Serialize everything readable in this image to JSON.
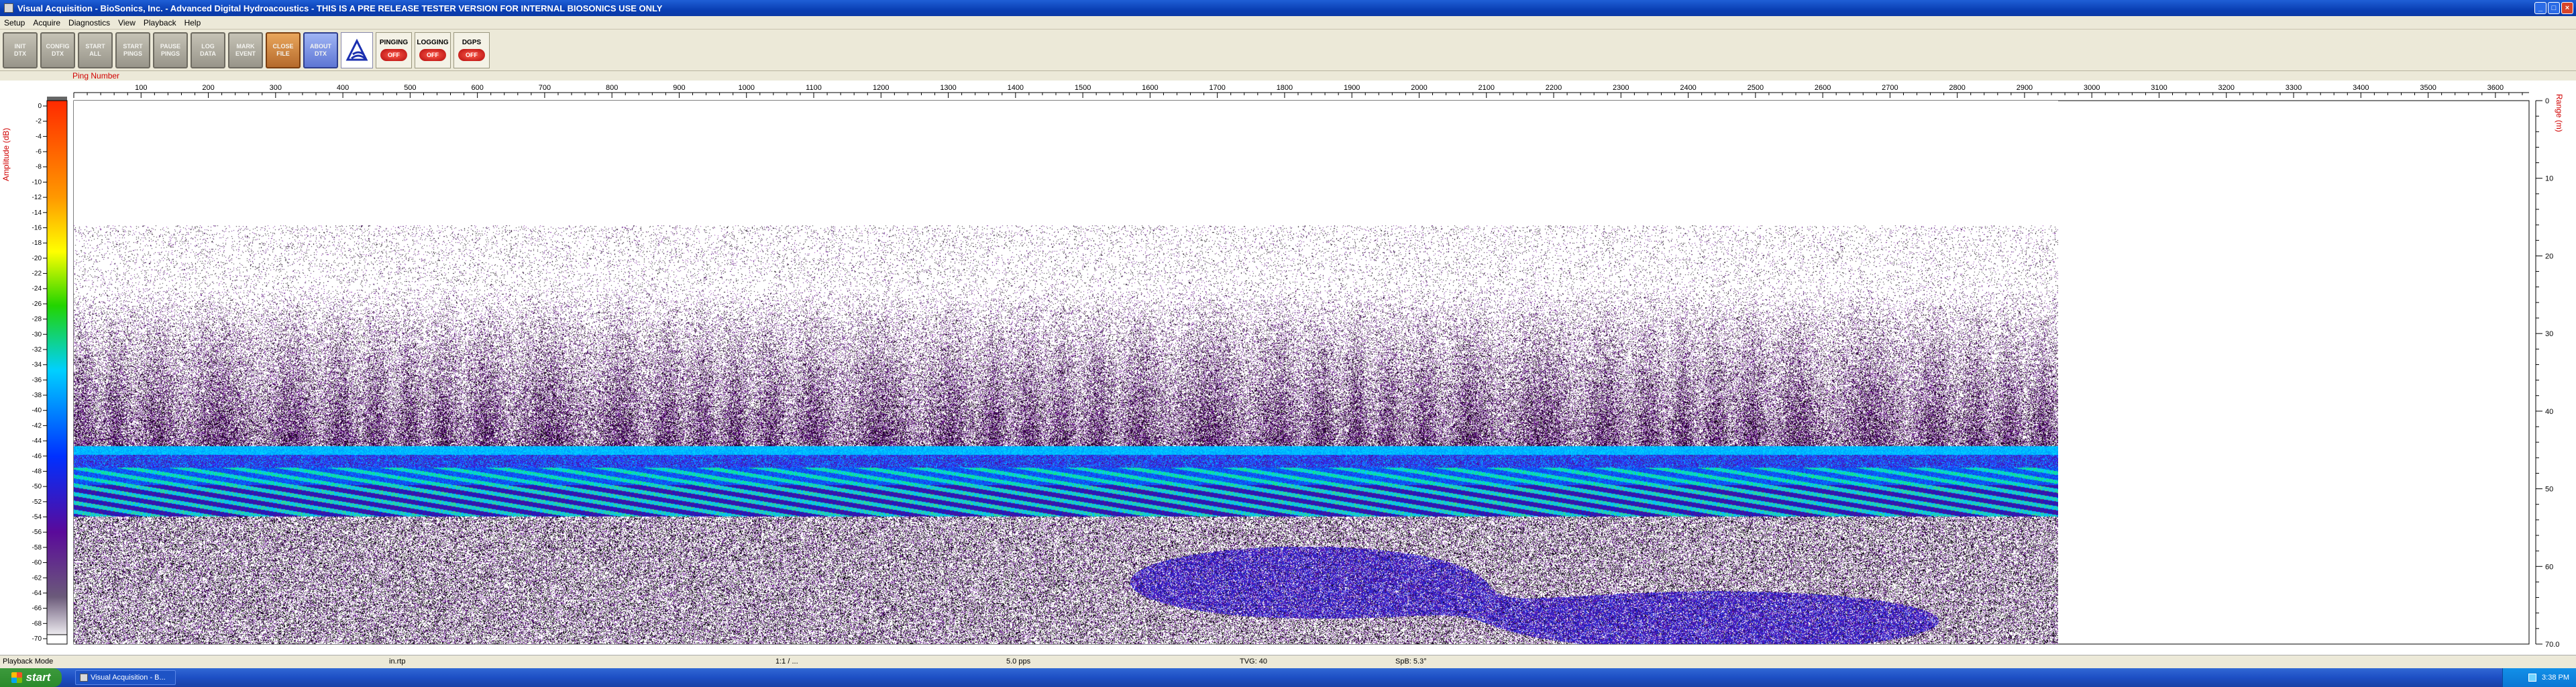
{
  "window": {
    "title": "Visual Acquisition  -  BioSonics, Inc.  -  Advanced Digital Hydroacoustics  -  THIS IS A PRE RELEASE TESTER VERSION FOR INTERNAL BIOSONICS USE ONLY"
  },
  "menu": [
    "Setup",
    "Acquire",
    "Diagnostics",
    "View",
    "Playback",
    "Help"
  ],
  "toolbar": {
    "buttons": [
      {
        "line1": "INIT",
        "line2": "DTX"
      },
      {
        "line1": "CONFIG",
        "line2": "DTX"
      },
      {
        "line1": "START",
        "line2": "ALL"
      },
      {
        "line1": "START",
        "line2": "PINGS"
      },
      {
        "line1": "PAUSE",
        "line2": "PINGS"
      },
      {
        "line1": "LOG",
        "line2": "DATA"
      },
      {
        "line1": "MARK",
        "line2": "EVENT"
      },
      {
        "line1": "CLOSE",
        "line2": "FILE"
      },
      {
        "line1": "ABOUT",
        "line2": "DTX"
      }
    ],
    "status": [
      {
        "label": "PINGING",
        "state": "OFF"
      },
      {
        "label": "LOGGING",
        "state": "OFF"
      },
      {
        "label": "DGPS",
        "state": "OFF"
      }
    ]
  },
  "echogram": {
    "ping_axis_label": "Ping Number",
    "amplitude_axis_label": "Amplitude (dB)",
    "range_axis_label": "Range (m)",
    "ping_ticks": [
      100,
      200,
      300,
      400,
      500,
      600,
      700,
      800,
      900,
      1000,
      1100,
      1200,
      1300,
      1400,
      1500,
      1600,
      1700,
      1800,
      1900,
      2000,
      2100,
      2200,
      2300,
      2400,
      2500,
      2600,
      2700,
      2800,
      2900,
      3000,
      3100,
      3200,
      3300,
      3400,
      3500,
      3600
    ],
    "amplitude_ticks": [
      0,
      -2,
      -4,
      -6,
      -8,
      -10,
      -12,
      -14,
      -16,
      -18,
      -20,
      -22,
      -24,
      -26,
      -28,
      -30,
      -32,
      -34,
      -36,
      -38,
      -40,
      -42,
      -44,
      -46,
      -48,
      -50,
      -52,
      -54,
      -56,
      -58,
      -60,
      -62,
      -64,
      -66,
      -68,
      -70
    ],
    "range_ticks": [
      {
        "value": 0,
        "label": "0"
      },
      {
        "value": 10,
        "label": "10"
      },
      {
        "value": 20,
        "label": "20"
      },
      {
        "value": 30,
        "label": "30"
      },
      {
        "value": 40,
        "label": "40"
      },
      {
        "value": 50,
        "label": "50"
      },
      {
        "value": 60,
        "label": "60"
      },
      {
        "value": 70,
        "label": "70.0"
      }
    ],
    "ping_max": 3650,
    "data_end_ping": 2950,
    "range_max_m": 70,
    "colors": {
      "bottom": "#00c8ff",
      "fish": "#4b0d7a",
      "accent": "#d00000"
    }
  },
  "statusbar": {
    "mode": "Playback Mode",
    "field1": "in.rtp",
    "field2": "1:1 / ...",
    "field3": "5.0 pps",
    "field4": "TVG: 40",
    "field5": "SpB: 5.3°"
  },
  "taskbar": {
    "start_label": "start",
    "task_label": "Visual Acquisition - B...",
    "clock": "3:38 PM"
  }
}
